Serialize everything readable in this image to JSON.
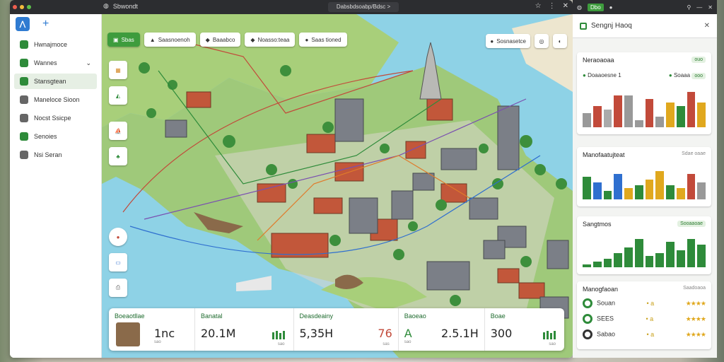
{
  "window": {
    "tab_title": "Sbwondt",
    "url": "Dabsbdsoabp/Bdsc >",
    "controls": [
      "☆",
      "⋮",
      "✕"
    ]
  },
  "sidebar": {
    "items": [
      {
        "label": "Hwnajmoce",
        "icon": "grid-icon",
        "color": "#2e8b3a",
        "active": false
      },
      {
        "label": "Wannes",
        "icon": "check-icon",
        "color": "#2e8b3a",
        "active": false
      },
      {
        "label": "Stansgtean",
        "icon": "list-icon",
        "color": "#2e8b3a",
        "active": true
      },
      {
        "label": "Maneloce Sioon",
        "icon": "info-icon",
        "color": "#666666",
        "active": false
      },
      {
        "label": "Nocst Ssicpe",
        "icon": "settings-icon",
        "color": "#666666",
        "active": false
      },
      {
        "label": "Senoies",
        "icon": "leaf-icon",
        "color": "#2e8b3a",
        "active": false
      },
      {
        "label": "Nsi Seran",
        "icon": "circle-icon",
        "color": "#666666",
        "active": false
      }
    ],
    "expand_glyph": "⌄"
  },
  "map": {
    "chips": [
      "Sbas",
      "Saasnoenoh",
      "Baaabco",
      "Noasso:teaa",
      "Saas tioned"
    ],
    "top_tools": [
      "Sosnasetce"
    ],
    "accent": "#3e9c3d"
  },
  "stats": [
    {
      "label": "Boeaotllae",
      "value": "1nc",
      "sub": "sao"
    },
    {
      "label": "Banatal",
      "value": "20.1M",
      "sub": "sao"
    },
    {
      "label": "Deasdeainy",
      "value": "5,35H",
      "sub": "sas"
    },
    {
      "label": "",
      "value": "76",
      "sub": ""
    },
    {
      "label": "Baoeao",
      "value": "A",
      "sub": "sao"
    },
    {
      "label": "",
      "value": "2.5.1H",
      "sub": ""
    },
    {
      "label": "Boae",
      "value": "300",
      "sub": "sao"
    }
  ],
  "panel": {
    "title": "Sengnj Haoq",
    "card1": {
      "title": "Neraoaoaa",
      "pill": "ouo",
      "tabs": [
        "Doaaoesne 1",
        "Soaaa"
      ],
      "pill2": "ooo"
    },
    "card2": {
      "title": "Manofaatujteat",
      "right": "Sdae oaae"
    },
    "card3": {
      "title": "Sangtmos",
      "pill": "Sooaaoae"
    },
    "card4": {
      "title": "Manogfaoan",
      "right": "Saadoaoa",
      "rows": [
        {
          "label": "Souan",
          "dots": "• a",
          "stars": "★★★★"
        },
        {
          "label": "SEES",
          "dots": "• a",
          "stars": "★★★★"
        },
        {
          "label": "Sabao",
          "dots": "• a",
          "stars": "★★★★"
        }
      ]
    }
  },
  "chart_data": [
    {
      "type": "bar",
      "series": [
        {
          "values": [
            4,
            6,
            5,
            9,
            9,
            2,
            8,
            3,
            7,
            6,
            10,
            7
          ]
        }
      ]
    },
    {
      "type": "bar",
      "series": [
        {
          "values": [
            8,
            6,
            3,
            9,
            4,
            5,
            7,
            10,
            5,
            4,
            9,
            6
          ]
        }
      ]
    },
    {
      "type": "bar",
      "series": [
        {
          "values": [
            1,
            2,
            3,
            5,
            7,
            10,
            4,
            5,
            9,
            6,
            10,
            8
          ]
        }
      ]
    }
  ]
}
